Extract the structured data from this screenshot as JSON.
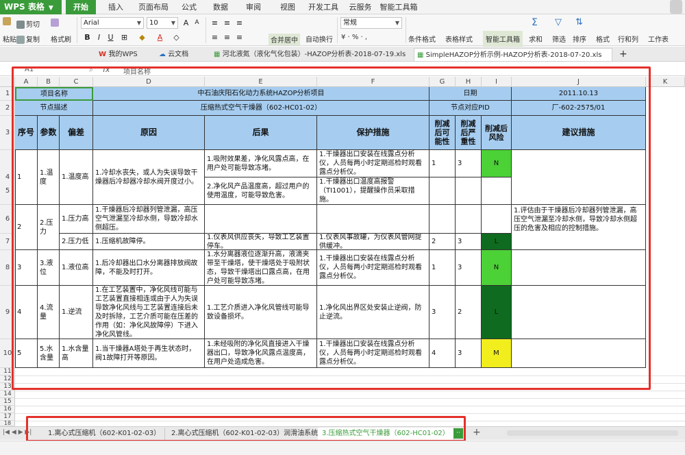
{
  "app": {
    "name": "WPS 表格"
  },
  "ribbon_tabs": [
    "开始",
    "插入",
    "页面布局",
    "公式",
    "数据",
    "审阅",
    "视图",
    "开发工具",
    "云服务",
    "智能工具箱"
  ],
  "ribbon": {
    "cut": "剪切",
    "copy": "复制",
    "paste": "粘贴",
    "format_painter": "格式刷",
    "font_name": "Arial",
    "font_size": "10",
    "merge_center": "合并居中",
    "wrap_text": "自动换行",
    "number_format": "常规",
    "conditional_format": "条件格式",
    "table_style": "表格样式",
    "smart_toolbox": "智能工具箱",
    "sum": "求和",
    "filter": "筛选",
    "sort": "排序",
    "format": "格式",
    "rows_cols": "行和列",
    "worksheet": "工作表"
  },
  "doc_tabs": [
    "我的WPS",
    "云文档",
    "河北液氮（液化气化包装）-HAZOP分析表-2018-07-19.xls",
    "SimpleHAZOP分析示例-HAZOP分析表-2018-07-20.xls"
  ],
  "formula_bar": {
    "name_box": "A1",
    "fx": "fx",
    "content": "项目名称"
  },
  "columns": [
    "A",
    "B",
    "C",
    "D",
    "E",
    "F",
    "G",
    "H",
    "I",
    "J",
    "K"
  ],
  "rows": [
    "1",
    "2",
    "3",
    "4",
    "5",
    "6",
    "7",
    "8",
    "9",
    "10",
    "11",
    "12",
    "13",
    "14",
    "15",
    "16",
    "17",
    "18"
  ],
  "sheet": {
    "r1": {
      "label": "项目名称",
      "project": "中石油庆阳石化动力系统HAZOP分析项目",
      "date_label": "日期",
      "date": "2011.10.13"
    },
    "r2": {
      "label": "节点描述",
      "node": "压缩热式空气干燥器（602-HC01-02）",
      "pid_label": "节点对应PID",
      "pid": "厂-602-2575/01"
    },
    "headers": {
      "seq": "序号",
      "param": "参数",
      "deviation": "偏差",
      "cause": "原因",
      "consequence": "后果",
      "protection": "保护措施",
      "likelihood": "削减后可能性",
      "severity": "削减后严重性",
      "risk": "削减后风险",
      "recommendation": "建议措施"
    },
    "groups": [
      {
        "seq": "1",
        "param": "1.温度"
      },
      {
        "seq": "2",
        "param": "2.压力"
      },
      {
        "seq": "3",
        "param": "3.液位"
      },
      {
        "seq": "4",
        "param": "4.流量"
      },
      {
        "seq": "5",
        "param": "5.水含量"
      }
    ],
    "rows": [
      {
        "deviation": "1.温度高",
        "cause": "1.冷却水丧失，或人为失误导致干燥器后冷却器冷却水阀开度过小。",
        "consequence": "1.吸附效果差，净化风露点高，在用户处可能导致冻堵。",
        "protection": "1.干燥器出口安装在线露点分析仪，人员每两小时定期巡检时观看露点分析仪。",
        "likelihood": "1",
        "severity": "3",
        "risk": "N",
        "recommendation": ""
      },
      {
        "deviation": "",
        "cause": "",
        "consequence": "2.净化风产品温度高，超过用户的使用温度，可能导致危害。",
        "protection": "1.干燥器出口温度高报警（TI1001），提醒操作员采取措施。",
        "likelihood": "",
        "severity": "",
        "risk": "",
        "recommendation": ""
      },
      {
        "deviation": "1.压力高",
        "cause": "1.干燥器后冷却器列管泄漏，高压空气泄漏至冷却水侧，导致冷却水侧超压。",
        "consequence": "",
        "protection": "",
        "likelihood": "",
        "severity": "",
        "risk": "",
        "recommendation": "1.评估由于干燥器后冷却器列管泄漏，高压空气泄漏至冷却水侧，导致冷却水侧超压的危害及相应的控制措施。"
      },
      {
        "deviation": "2.压力低",
        "cause": "1.压缩机故障停。",
        "consequence": "1.仪表风供应丧失，导致工艺装置停车。",
        "protection": "1.仪表风事故罐，为仪表风管网提供缓冲。",
        "likelihood": "2",
        "severity": "3",
        "risk": "L",
        "recommendation": ""
      },
      {
        "deviation": "1.液位高",
        "cause": "1.后冷却器出口水分离器排放阀故障，不能及时打开。",
        "consequence": "1.水分离器液位逐渐升高，液滴夹带至干燥塔，使干燥塔处于吸附状态，导致干燥塔出口露点高，在用户处可能导致冻堵。",
        "protection": "1.干燥器出口安装在线露点分析仪，人员每两小时定期巡检时观看露点分析仪。",
        "likelihood": "1",
        "severity": "3",
        "risk": "N",
        "recommendation": ""
      },
      {
        "deviation": "1.逆流",
        "cause": "1.在工艺装置中，净化风线可能与工艺装置直接相连或由于人为失误导致净化风线与工艺装置连接后未及时拆除，工艺介质可能在压差的作用（如：净化风故障停）下进入净化风管线。",
        "consequence": "1.工艺介质进入净化风管线可能导致设备损坏。",
        "protection": "1.净化风出界区处安装止逆阀，防止逆流。",
        "likelihood": "3",
        "severity": "2",
        "risk": "L",
        "recommendation": ""
      },
      {
        "deviation": "1.水含量高",
        "cause": "1.当干燥器A塔处于再生状态时，阀1故障打开等原因。",
        "consequence": "1.未经吸附的净化风直接进入干燥器出口，导致净化风露点温度高，在用户处造成危害。",
        "protection": "1.干燥器出口安装在线露点分析仪，人员每两小时定期巡检时观看露点分析仪。",
        "likelihood": "4",
        "severity": "3",
        "risk": "M",
        "recommendation": ""
      }
    ]
  },
  "sheet_tabs": [
    "1.离心式压缩机（602-K01-02-03）",
    "2.离心式压缩机（602-K01-02-03）润滑油系统",
    "3.压缩热式空气干燥器（602-HC01-02）"
  ],
  "colors": {
    "header_blue": "#a6cdf0",
    "risk_N": "#4cd137",
    "risk_L": "#0f6b1f",
    "risk_M": "#f2ee1e",
    "highlight": "#e4302a",
    "app_green": "#3a9b3a"
  }
}
